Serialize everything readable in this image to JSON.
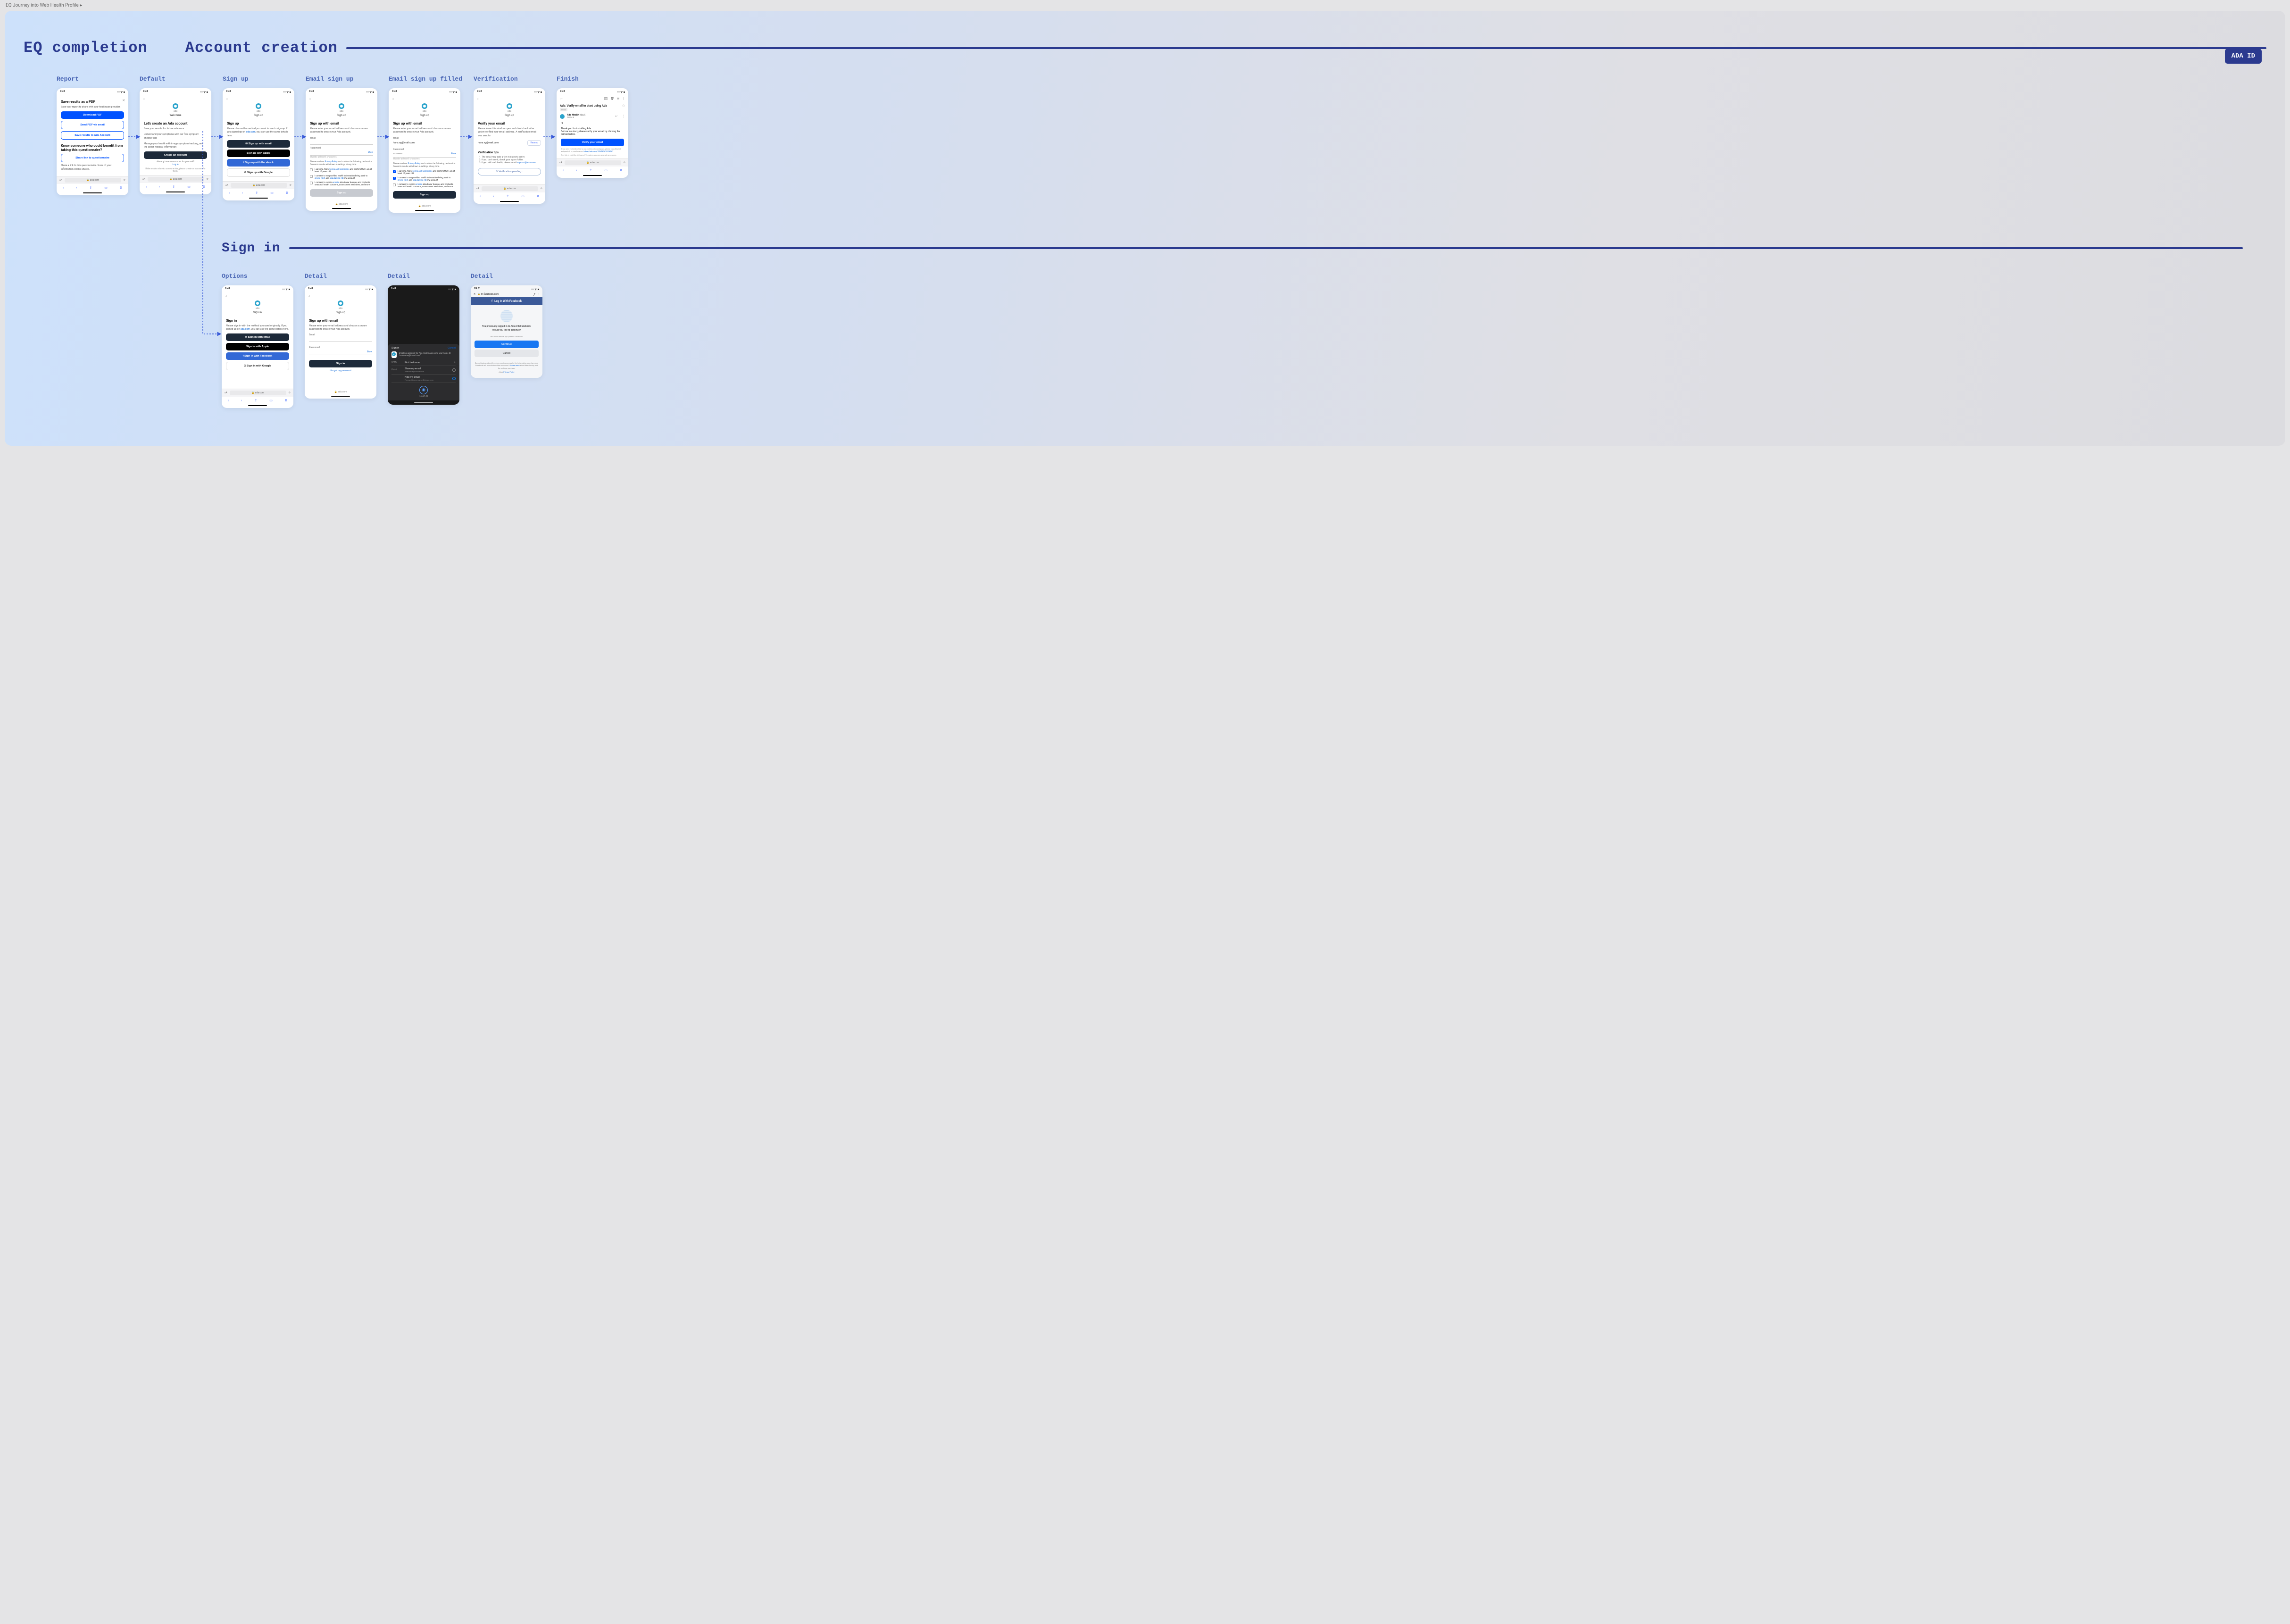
{
  "breadcrumb": "EQ Journey into Web Health Profile ▸",
  "badge": "ADA ID",
  "sections": {
    "eq": "EQ completion",
    "acct": "Account creation",
    "signin": "Sign in"
  },
  "labels": {
    "report": "Report",
    "default": "Default",
    "signup": "Sign up",
    "email_signup": "Email sign up",
    "email_signup_filled": "Email sign up filled",
    "verification": "Verification",
    "finish": "Finish",
    "options": "Options",
    "detail": "Detail"
  },
  "common": {
    "time": "9:41",
    "carrier": "▬ 04:04 PM ◀",
    "signals": "••• ᯤ ■",
    "back": "‹",
    "ada": "ada",
    "url": "🔒 ada.com",
    "secure_ada": "🔒 ada.com",
    "welcome": "Welcome",
    "signup_title": "Sign up",
    "aA": "ᴀA",
    "reload": "⟳",
    "show": "Show"
  },
  "report": {
    "title": "Save results as a PDF",
    "desc": "Save your report to share with your healthcare provider.",
    "download": "Download PDF",
    "send_email": "Send PDF via email",
    "save_acct": "Save results to Ada Account",
    "benefit_title": "Know someone who could benefit from taking this questionnaire?",
    "share_link": "Share link to questionnaire",
    "share_note": "Share a link to this questionnaire. None of your information will be shared."
  },
  "default_screen": {
    "title": "Let's create an Ada account",
    "line1": "Save your results for future reference",
    "line2": "Understand your symptoms with our free symptom checker app",
    "line3": "Manage your health with in-app symptom tracking, and the latest medical information",
    "create": "Create an account",
    "already": "Already have an account for yourself?",
    "login": "Log in",
    "relate": "If the results relate to someone else, please create an account for them."
  },
  "signup": {
    "title": "Sign up",
    "desc_a": "Please choose the method you want to use to sign up. If you signed up on ",
    "desc_link": "ada.com",
    "desc_b": ", you can use the same details here.",
    "email": "Sign up with email",
    "apple": "Sign up with Apple",
    "facebook": "Sign up with Facebook",
    "google": "Sign up with Google"
  },
  "email_form": {
    "title": "Sign up with email",
    "desc": "Please enter your email address and choose a secure password to create your Ada account.",
    "email_label": "Email",
    "email_value": "hans.vg@mail.com",
    "pwd_label": "Password",
    "pwd_value": "•••••••••••",
    "help_email": "Must be at least 6 characters",
    "help_pwd": "Must be at least 8 characters",
    "legal_pre": "Please read our ",
    "privacy": "Privacy Policy",
    "legal_mid": " and confirm the following declaration. Consents can be withdrawn in settings at any time.",
    "chk1_a": "I agree to Ada's ",
    "terms": "Terms and Conditions",
    "chk1_b": " and confirm that I am at least 16 years old",
    "chk2_a": "I consent to my provided health information being used to ",
    "create_link": "create (3.2)",
    "chk2_b": " and ",
    "populate_link": "populate (3.18)",
    "chk2_c": " my account",
    "chk3_a": "I consent to receive ",
    "emails_link": "emails",
    "chk3_b": " about new features and products, seasonal health concerns, assessment reminders, and more",
    "submit": "Sign up"
  },
  "verify": {
    "title": "Verify your email",
    "desc": "Please leave this window open and check back after you've verified your email address. A verification email was sent to:",
    "email": "hans.vg@mail.com",
    "resend": "Resend",
    "tips_title": "Verification tips",
    "tip1": "The email may take a few minutes to arrive.",
    "tip2": "If you can't see it, check your spam folder.",
    "tip3": "If you still can't find it, please email",
    "support": "support@ada.com",
    "pending": "Verification pending…"
  },
  "finish": {
    "star": "☆",
    "subject": "Ada: Verify email to start using Ada",
    "inbox_tag": "Inbox",
    "sender": "Ada Health",
    "sender_sub": "to me ▾",
    "date": "May 5",
    "reply": "↩",
    "more": "⋮",
    "greeting": "Hi",
    "body1": "Thank you for installing Ada.",
    "body2": "Before we start, please verify your email by clicking the button below.",
    "verify_btn": "Verify your email",
    "foot1": "If you were not redirected to our confirmation webpage, please copy this link and paste it in your browser: ",
    "foot_link": "https://ada.com/1234567678106567",
    "foot2": "This link is valid for 48 hours. If it expires, you can generate a new one."
  },
  "signin_opt": {
    "title": "Sign in",
    "desc_a": "Please sign in with the method you used originally. If you signed up on ",
    "desc_link": "ada.com",
    "desc_b": ", you can use the same details here.",
    "email": "Sign in with email",
    "apple": "Sign in with Apple",
    "facebook": "Sign in with Facebook",
    "google": "Sign in with Google"
  },
  "signin_email": {
    "title": "Sign up with email",
    "desc": "Please enter your email address and choose a secure password to create your Ada account.",
    "email_label": "Email",
    "pwd_label": "Password",
    "submit": "Sign in",
    "forgot": "I forgot my password"
  },
  "appleid": {
    "signin_label": "Sign in",
    "cancel": "Cancel",
    "blurb": "Create an account for Ada Health App using your Apple ID \"username@icloud.com\".",
    "name_label": "NAME",
    "name_value": "First lastname",
    "share": "Share my email",
    "share_sub": "username@icloud.com",
    "hide": "Hide my email",
    "hide_sub": "Forward to username@icloud.com",
    "touchid": "Touch ID"
  },
  "fb": {
    "header": "Log In With Facebook",
    "url": "🔒 m.facebook.com",
    "previously": "You previously logged in to Ada with Facebook.",
    "would": "Would you like to continue?",
    "continue": "Continue",
    "cancel": "Cancel",
    "warn": "This won't let the app post to Facebook.",
    "legal_a": "By continuing, Ada will receive ongoing access to the information you share and Facebook will record when Ada accesses it. ",
    "learn": "Learn more",
    "legal_b": " about this sharing and the settings you have.",
    "policy_a": "Ada's ",
    "policy_link": "Privacy Policy"
  },
  "android_time": "09:51",
  "tabs": {
    "back": "‹",
    "fwd": "›",
    "share": "⇪",
    "book": "▭",
    "tabs": "⧉"
  }
}
